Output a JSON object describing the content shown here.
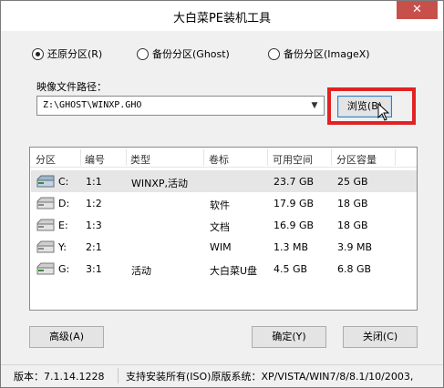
{
  "window": {
    "title": "大白菜PE装机工具",
    "close_glyph": "✕"
  },
  "radio_options": [
    {
      "label": "还原分区(R)",
      "selected": true
    },
    {
      "label": "备份分区(Ghost)",
      "selected": false
    },
    {
      "label": "备份分区(ImageX)",
      "selected": false
    }
  ],
  "image_path": {
    "label": "映像文件路径：",
    "value": "Z:\\GHOST\\WINXP.GHO",
    "dropdown_glyph": "▼"
  },
  "browse_button": {
    "label": "浏览(B)"
  },
  "table": {
    "headers": [
      "分区",
      "编号",
      "类型",
      "卷标",
      "可用空间",
      "分区容量"
    ],
    "rows": [
      {
        "partition": "C:",
        "number": "1:1",
        "type": "WINXP,活动",
        "label": "",
        "free": "23.7 GB",
        "capacity": "25 GB",
        "selected": true
      },
      {
        "partition": "D:",
        "number": "1:2",
        "type": "",
        "label": "软件",
        "free": "17.9 GB",
        "capacity": "18 GB",
        "selected": false
      },
      {
        "partition": "E:",
        "number": "1:3",
        "type": "",
        "label": "文档",
        "free": "16.9 GB",
        "capacity": "18 GB",
        "selected": false
      },
      {
        "partition": "Y:",
        "number": "2:1",
        "type": "",
        "label": "WIM",
        "free": "1.3 MB",
        "capacity": "3.9 MB",
        "selected": false
      },
      {
        "partition": "G:",
        "number": "3:1",
        "type": "活动",
        "label": "大白菜U盘",
        "free": "4.5 GB",
        "capacity": "6.8 GB",
        "selected": false
      }
    ]
  },
  "buttons": {
    "advanced": "高级(A)",
    "ok": "确定(Y)",
    "close": "关闭(C)"
  },
  "status_bar": {
    "version": "版本：7.1.14.1228",
    "support": "支持安装所有(ISO)原版系统：XP/VISTA/WIN7/8/8.1/10/2003,"
  },
  "colors": {
    "highlight": "#e22222",
    "close_button": "#c7504b",
    "selected_row": "#e6e6e6"
  }
}
